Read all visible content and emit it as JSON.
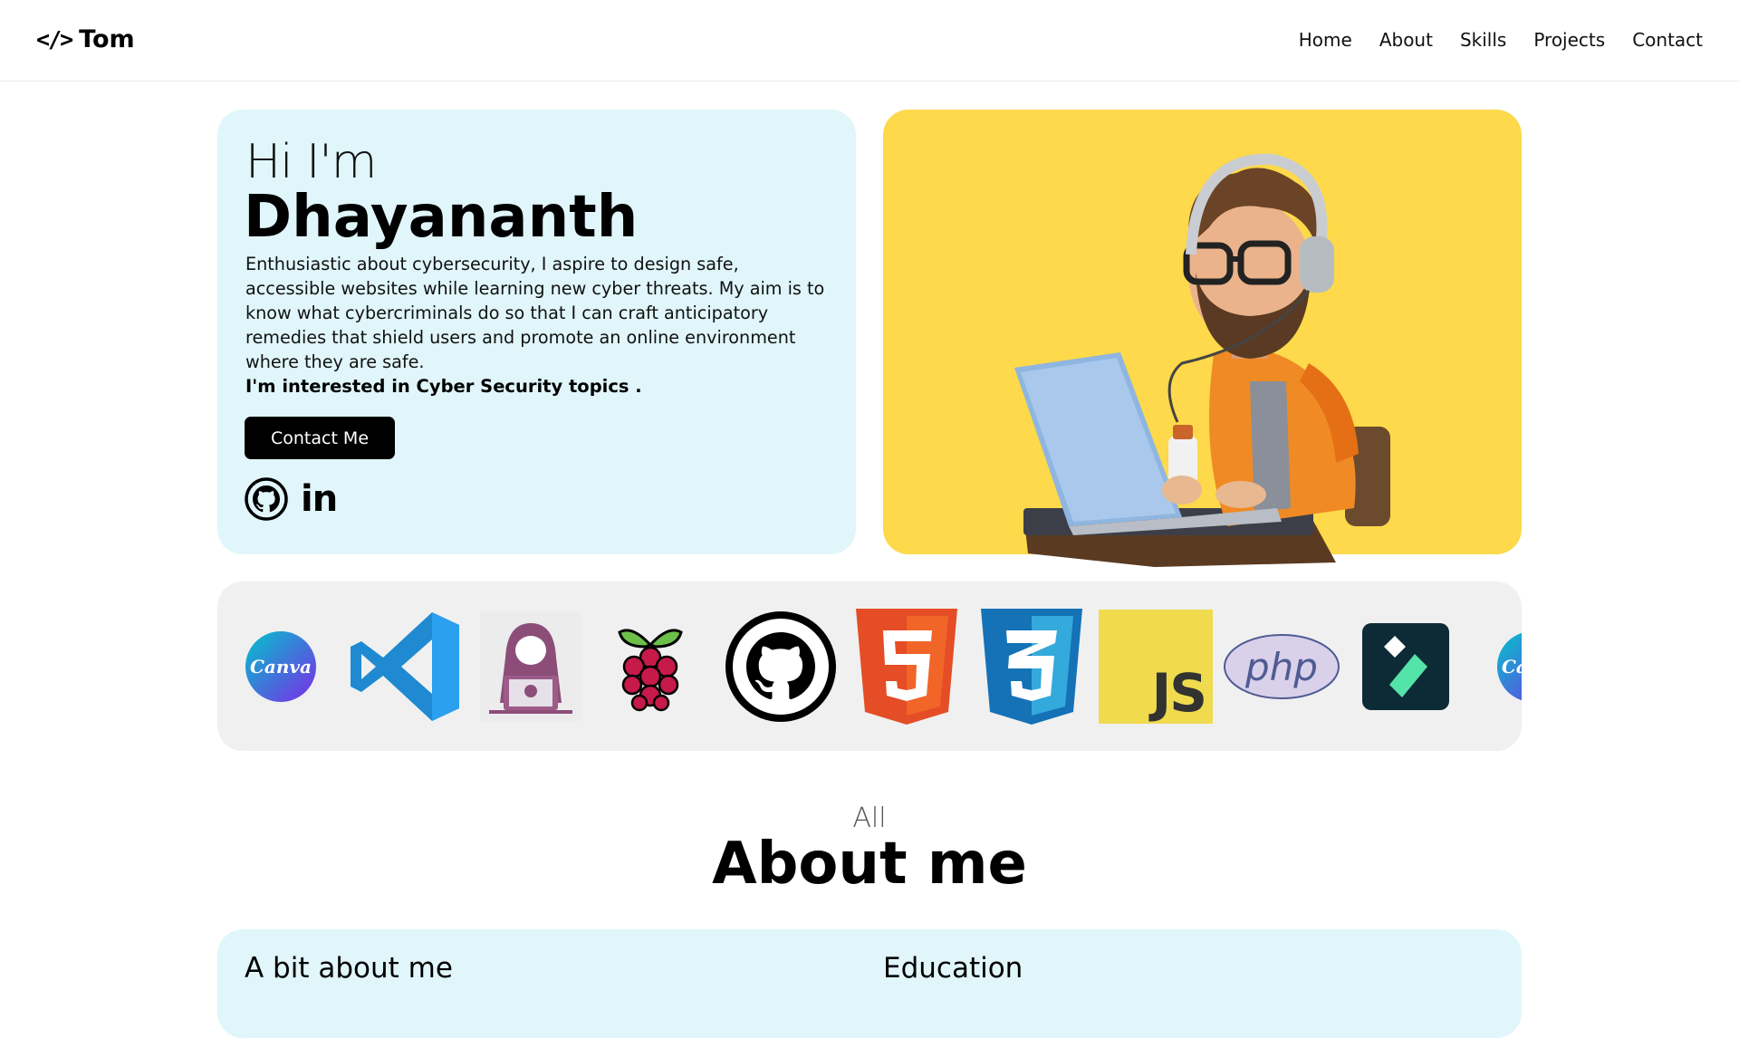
{
  "nav": {
    "logo_text": "Tom",
    "logo_icon": "</>",
    "links": [
      "Home",
      "About",
      "Skills",
      "Projects",
      "Contact"
    ]
  },
  "hero": {
    "greeting": "Hi I'm",
    "name": "Dhayananth",
    "description": "Enthusiastic about cybersecurity, I aspire to design safe, accessible websites while learning new cyber threats. My aim is to know what cybercriminals do so that I can craft anticipatory remedies that shield users and promote an online environment where they are safe.",
    "interest": "I'm interested in Cyber Security topics .",
    "contact_button": "Contact Me",
    "social_linkedin_text": "in"
  },
  "skills": {
    "canva_label": "Canva",
    "php_label": "php",
    "js_label": "JS",
    "html_number": "5",
    "css_number": "3"
  },
  "about": {
    "subtitle": "All",
    "title": "About me",
    "col1_title": "A bit about me",
    "col2_title": "Education"
  },
  "colors": {
    "hero_bg": "#e0f6fb",
    "image_bg": "#fdd94b",
    "strip_bg": "#f0f0f0"
  }
}
